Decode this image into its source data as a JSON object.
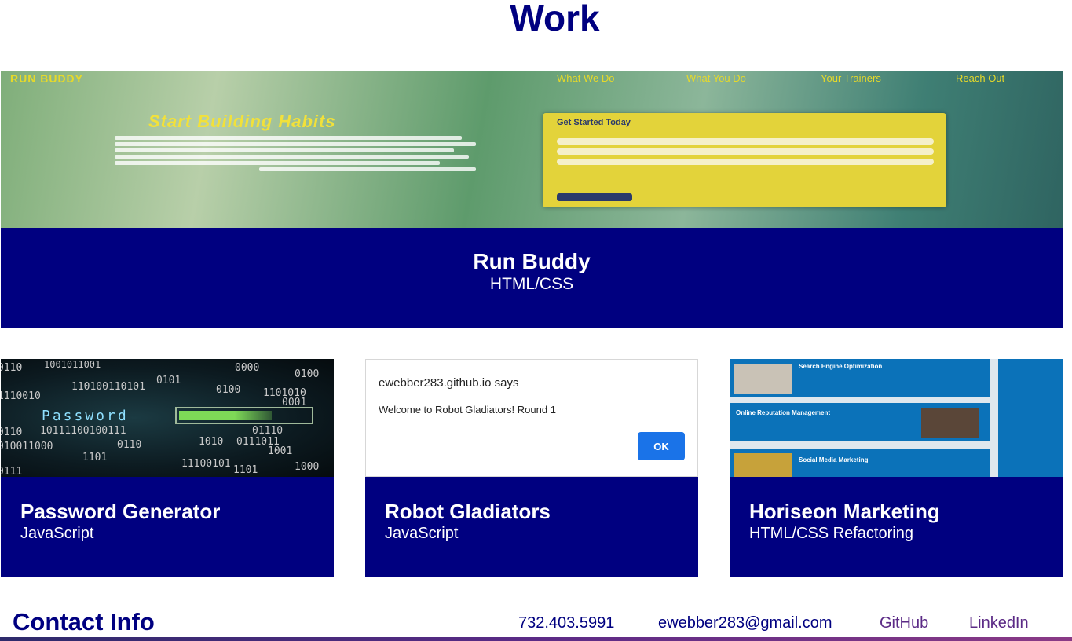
{
  "work": {
    "title": "Work"
  },
  "projects": {
    "featured": {
      "name": "Run Buddy",
      "tech": "HTML/CSS",
      "screenshot": {
        "logo": "RUN BUDDY",
        "nav": [
          "What We Do",
          "What You Do",
          "Your Trainers",
          "Reach Out"
        ],
        "headline": "Start Building Habits",
        "form_title": "Get Started Today"
      }
    },
    "password": {
      "name": "Password Generator",
      "tech": "JavaScript",
      "screenshot": {
        "label": "Password",
        "stars": "* * * *"
      }
    },
    "robot": {
      "name": "Robot Gladiators",
      "tech": "JavaScript",
      "screenshot": {
        "dialog_title": "ewebber283.github.io says",
        "dialog_message": "Welcome to Robot Gladiators! Round 1",
        "ok_label": "OK"
      }
    },
    "horiseon": {
      "name": "Horiseon Marketing",
      "tech": "HTML/CSS Refactoring",
      "screenshot": {
        "sections": [
          "Search Engine Optimization",
          "Online Reputation Management",
          "Social Media Marketing"
        ]
      }
    }
  },
  "contact": {
    "title": "Contact Info",
    "phone": "732.403.5991",
    "email": "ewebber283@gmail.com",
    "github": "GitHub",
    "linkedin": "LinkedIn"
  },
  "colors": {
    "brand": "#000080",
    "link_visited": "#5b2a86"
  }
}
